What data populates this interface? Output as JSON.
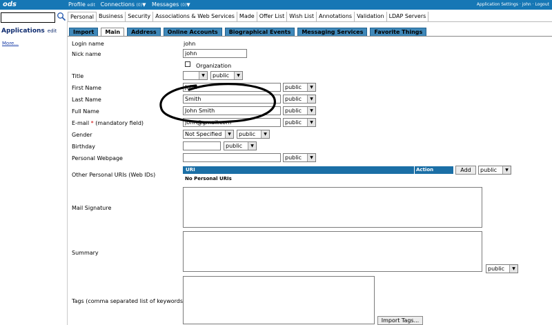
{
  "topbar": {
    "logo": "ods",
    "profile": "Profile",
    "profile_edit": "edit",
    "connections": "Connections",
    "connections_count": "(0)",
    "messages": "Messages",
    "messages_count": "(0)",
    "app_settings": "Application Settings",
    "separator": "·",
    "user": "john",
    "logout": "Logout",
    "caret": "▼"
  },
  "sidebar": {
    "search_value": "",
    "applications": "Applications",
    "edit": "edit",
    "more": "More..."
  },
  "main_tabs": [
    "Personal",
    "Business",
    "Security",
    "Associations & Web Services",
    "Made",
    "Offer List",
    "Wish List",
    "Annotations",
    "Validation",
    "LDAP Servers"
  ],
  "sub_tabs": [
    "Import",
    "Main",
    "Address",
    "Online Accounts",
    "Biographical Events",
    "Messaging Services",
    "Favorite Things"
  ],
  "form": {
    "login_name": {
      "label": "Login name",
      "value": "john"
    },
    "nick_name": {
      "label": "Nick name",
      "value": "john"
    },
    "organization": {
      "label": "Organization"
    },
    "title": {
      "label": "Title",
      "value": "",
      "visibility": "public"
    },
    "first_name": {
      "label": "First Name",
      "value": "John",
      "visibility": "public"
    },
    "last_name": {
      "label": "Last Name",
      "value": "Smith",
      "visibility": "public"
    },
    "full_name": {
      "label": "Full Name",
      "value": "John Smith",
      "visibility": "public"
    },
    "email": {
      "label": "E-mail",
      "required_mark": "*",
      "required_note": "(mandatory field)",
      "value": "john@gmail.com",
      "visibility": "public"
    },
    "gender": {
      "label": "Gender",
      "value": "Not Specified",
      "visibility": "public"
    },
    "birthday": {
      "label": "Birthday",
      "value": "",
      "visibility": "public"
    },
    "webpage": {
      "label": "Personal Webpage",
      "value": "",
      "visibility": "public"
    },
    "other_uris": {
      "label": "Other Personal URIs (Web IDs)",
      "col_uri": "URI",
      "col_action": "Action",
      "empty": "No Personal URIs",
      "add": "Add",
      "visibility": "public"
    },
    "mail_signature": {
      "label": "Mail Signature"
    },
    "summary": {
      "label": "Summary",
      "visibility": "public"
    },
    "tags": {
      "label": "Tags (comma separated list of keywords)",
      "import": "Import Tags..."
    }
  },
  "annotation_color": "#000000"
}
